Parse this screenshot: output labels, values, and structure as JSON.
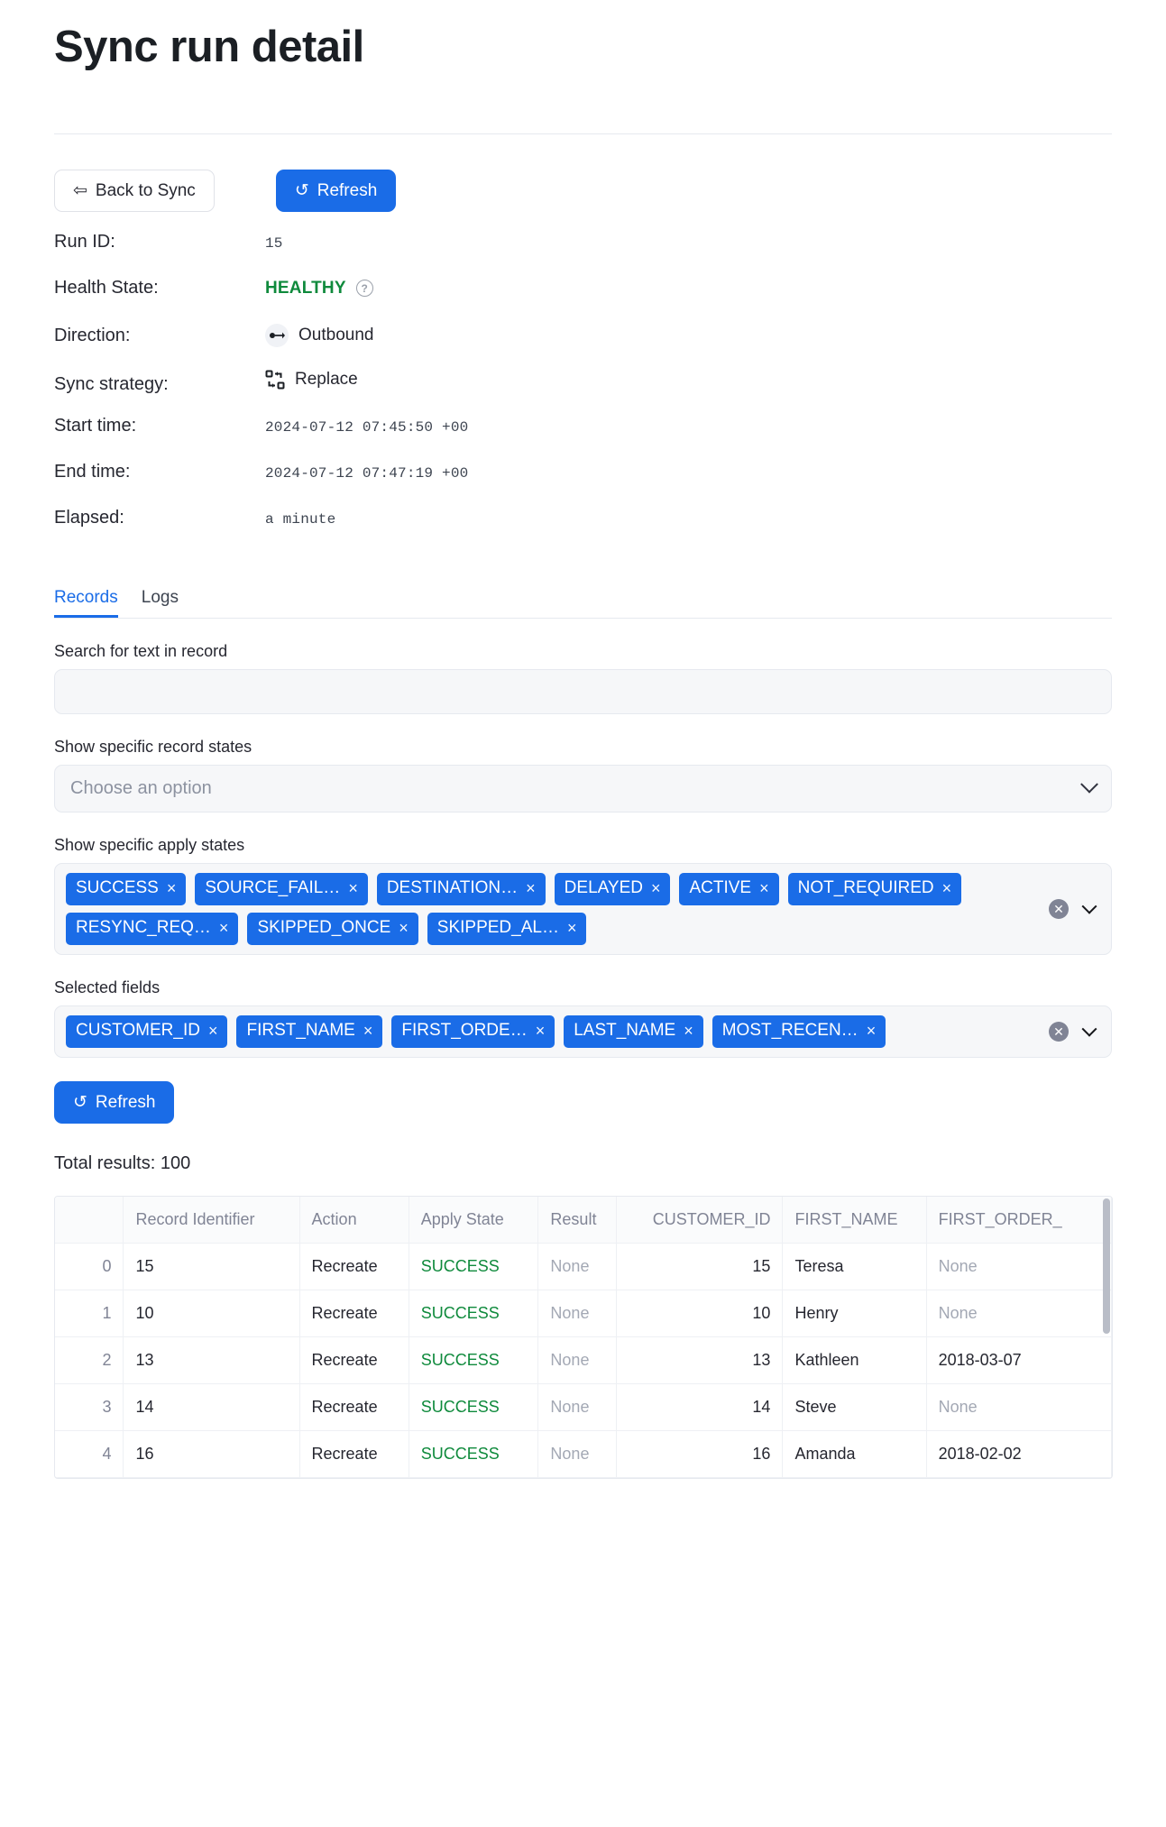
{
  "page": {
    "title": "Sync run detail"
  },
  "actions": {
    "back_label": "Back to Sync",
    "back_icon": "arrow-left-icon",
    "refresh_label": "Refresh",
    "refresh_icon": "refresh-icon"
  },
  "meta": {
    "rows": [
      {
        "label": "Run ID:",
        "value": "15",
        "kind": "mono"
      },
      {
        "label": "Health State:",
        "value": "HEALTHY",
        "kind": "health",
        "help_icon": "question-mark-icon"
      },
      {
        "label": "Direction:",
        "value": "Outbound",
        "kind": "icon",
        "icon": "outbound-arrow-icon"
      },
      {
        "label": "Sync strategy:",
        "value": "Replace",
        "kind": "icon",
        "icon": "replace-shuffle-icon"
      },
      {
        "label": "Start time:",
        "value": "2024-07-12 07:45:50 +00:0",
        "kind": "mono"
      },
      {
        "label": "End time:",
        "value": "2024-07-12 07:47:19 +00:0",
        "kind": "mono"
      },
      {
        "label": "Elapsed:",
        "value": "a minute",
        "kind": "mono"
      }
    ]
  },
  "tabs": [
    {
      "label": "Records",
      "active": true
    },
    {
      "label": "Logs",
      "active": false
    }
  ],
  "filters": {
    "search_label": "Search for text in record",
    "search_value": "",
    "search_placeholder": "",
    "record_states_label": "Show specific record states",
    "record_states_placeholder": "Choose an option",
    "apply_states_label": "Show specific apply states",
    "apply_states_chips": [
      "SUCCESS",
      "SOURCE_FAIL…",
      "DESTINATION…",
      "DELAYED",
      "ACTIVE",
      "NOT_REQUIRED",
      "RESYNC_REQ…",
      "SKIPPED_ONCE",
      "SKIPPED_AL…"
    ],
    "selected_fields_label": "Selected fields",
    "selected_fields_chips": [
      "CUSTOMER_ID",
      "FIRST_NAME",
      "FIRST_ORDE…",
      "LAST_NAME",
      "MOST_RECEN…"
    ],
    "chip_remove_icon": "close-x-icon",
    "clear_all_icon": "clear-circle-icon",
    "dropdown_icon": "chevron-down-icon",
    "refresh_label": "Refresh",
    "refresh_icon": "refresh-icon"
  },
  "results": {
    "total_label": "Total results: 100",
    "columns": [
      "",
      "Record Identifier",
      "Action",
      "Apply State",
      "Result",
      "CUSTOMER_ID",
      "FIRST_NAME",
      "FIRST_ORDER_"
    ],
    "rows": [
      {
        "idx": "0",
        "record_identifier": "15",
        "action": "Recreate",
        "apply_state": "SUCCESS",
        "result": "None",
        "customer_id": "15",
        "first_name": "Teresa",
        "first_order": "None"
      },
      {
        "idx": "1",
        "record_identifier": "10",
        "action": "Recreate",
        "apply_state": "SUCCESS",
        "result": "None",
        "customer_id": "10",
        "first_name": "Henry",
        "first_order": "None"
      },
      {
        "idx": "2",
        "record_identifier": "13",
        "action": "Recreate",
        "apply_state": "SUCCESS",
        "result": "None",
        "customer_id": "13",
        "first_name": "Kathleen",
        "first_order": "2018-03-07"
      },
      {
        "idx": "3",
        "record_identifier": "14",
        "action": "Recreate",
        "apply_state": "SUCCESS",
        "result": "None",
        "customer_id": "14",
        "first_name": "Steve",
        "first_order": "None"
      },
      {
        "idx": "4",
        "record_identifier": "16",
        "action": "Recreate",
        "apply_state": "SUCCESS",
        "result": "None",
        "customer_id": "16",
        "first_name": "Amanda",
        "first_order": "2018-02-02"
      }
    ]
  },
  "colors": {
    "accent": "#1a6ce7",
    "success": "#0f8a3c",
    "muted": "#a3a8b4"
  }
}
